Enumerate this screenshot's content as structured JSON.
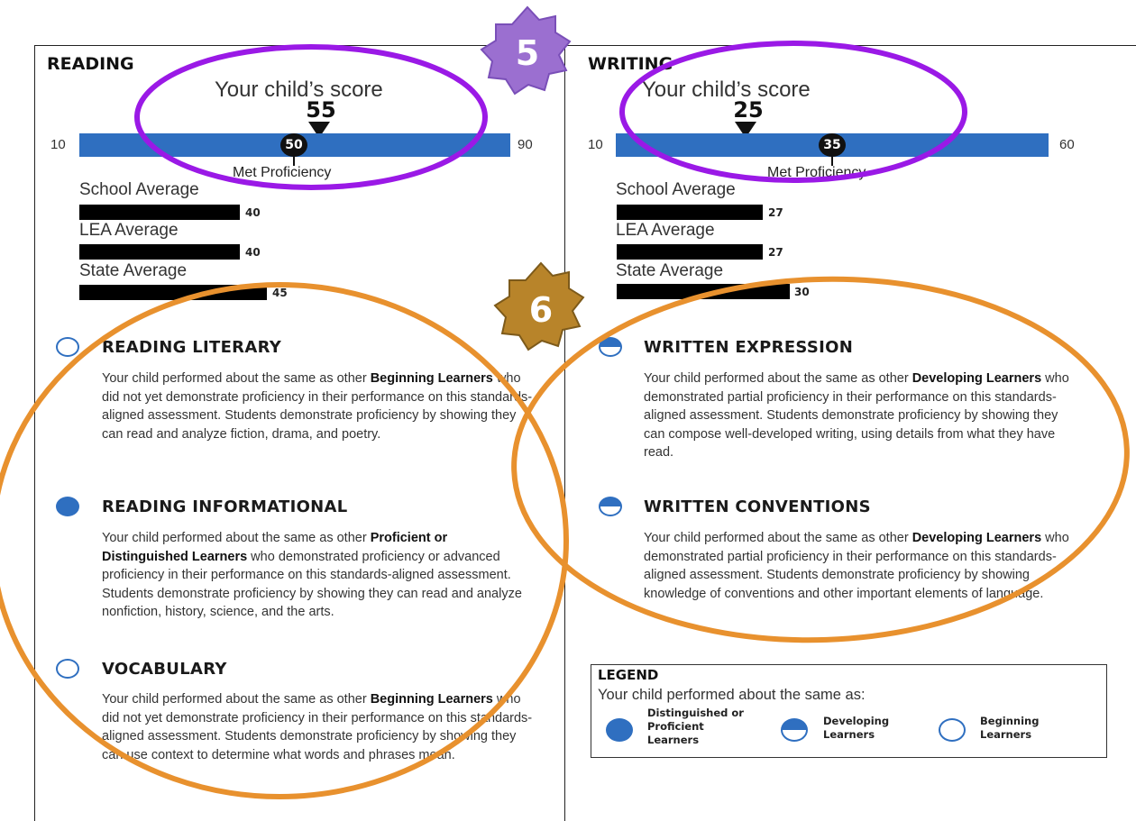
{
  "reading": {
    "title": "READING",
    "score_caption": "Your child’s score",
    "score": "55",
    "scale_min": "10",
    "scale_max": "90",
    "proficiency_value": "50",
    "proficiency_label": "Met Proficiency",
    "averages": [
      {
        "label": "School Average",
        "value": "40"
      },
      {
        "label": "LEA Average",
        "value": "40"
      },
      {
        "label": "State Average",
        "value": "45"
      }
    ],
    "categories": [
      {
        "level": "beginning",
        "title": "READING LITERARY",
        "pre": "Your child performed about the same as other ",
        "bold": "Beginning Learners",
        "post": " who did not yet demonstrate proficiency in their performance on this standards-aligned assessment. Students demonstrate proficiency by showing they can read and analyze fiction, drama, and poetry."
      },
      {
        "level": "proficient",
        "title": "READING INFORMATIONAL",
        "pre": "Your child performed about the same as other ",
        "bold": "Proficient or Distinguished Learners",
        "post": " who demonstrated proficiency or advanced proficiency in their performance on this standards-aligned assessment. Students demonstrate proficiency by showing they can read and analyze nonfiction, history, science, and the arts."
      },
      {
        "level": "beginning",
        "title": "VOCABULARY",
        "pre": "Your child performed about the same as other ",
        "bold": "Beginning Learners",
        "post": " who did not yet demonstrate proficiency in their performance on this standards-aligned assessment. Students demonstrate proficiency by showing they can use context to determine what words and phrases mean."
      }
    ]
  },
  "writing": {
    "title": "WRITING",
    "score_caption": "Your child’s score",
    "score": "25",
    "scale_min": "10",
    "scale_max": "60",
    "proficiency_value": "35",
    "proficiency_label": "Met Proficiency",
    "averages": [
      {
        "label": "School Average",
        "value": "27"
      },
      {
        "label": "LEA Average",
        "value": "27"
      },
      {
        "label": "State Average",
        "value": "30"
      }
    ],
    "categories": [
      {
        "level": "developing",
        "title": "WRITTEN EXPRESSION",
        "pre": "Your child performed about the same as other ",
        "bold": "Developing Learners",
        "post": " who demonstrated partial proficiency in their performance on this standards-aligned assessment. Students demonstrate proficiency by showing they can compose well-developed writing, using details from what they have read."
      },
      {
        "level": "developing",
        "title": "WRITTEN CONVENTIONS",
        "pre": "Your child performed about the same as other ",
        "bold": "Developing Learners",
        "post": " who demonstrated partial proficiency in their performance on this standards-aligned assessment. Students demonstrate proficiency by showing knowledge of conventions and other important elements of language."
      }
    ]
  },
  "legend": {
    "title": "LEGEND",
    "subtitle": "Your child performed about the same as:",
    "items": [
      {
        "level": "proficient",
        "label": "Distinguished or Proficient Learners"
      },
      {
        "level": "developing",
        "label": "Developing Learners"
      },
      {
        "level": "beginning",
        "label": "Beginning Learners"
      }
    ]
  },
  "badges": [
    {
      "number": "5",
      "color": "#9b6fd0"
    },
    {
      "number": "6",
      "color": "#b8842a"
    }
  ],
  "colors": {
    "accent": "#2f6fc0",
    "purple_annotation": "#9a19e6",
    "orange_annotation": "#e8912e"
  }
}
